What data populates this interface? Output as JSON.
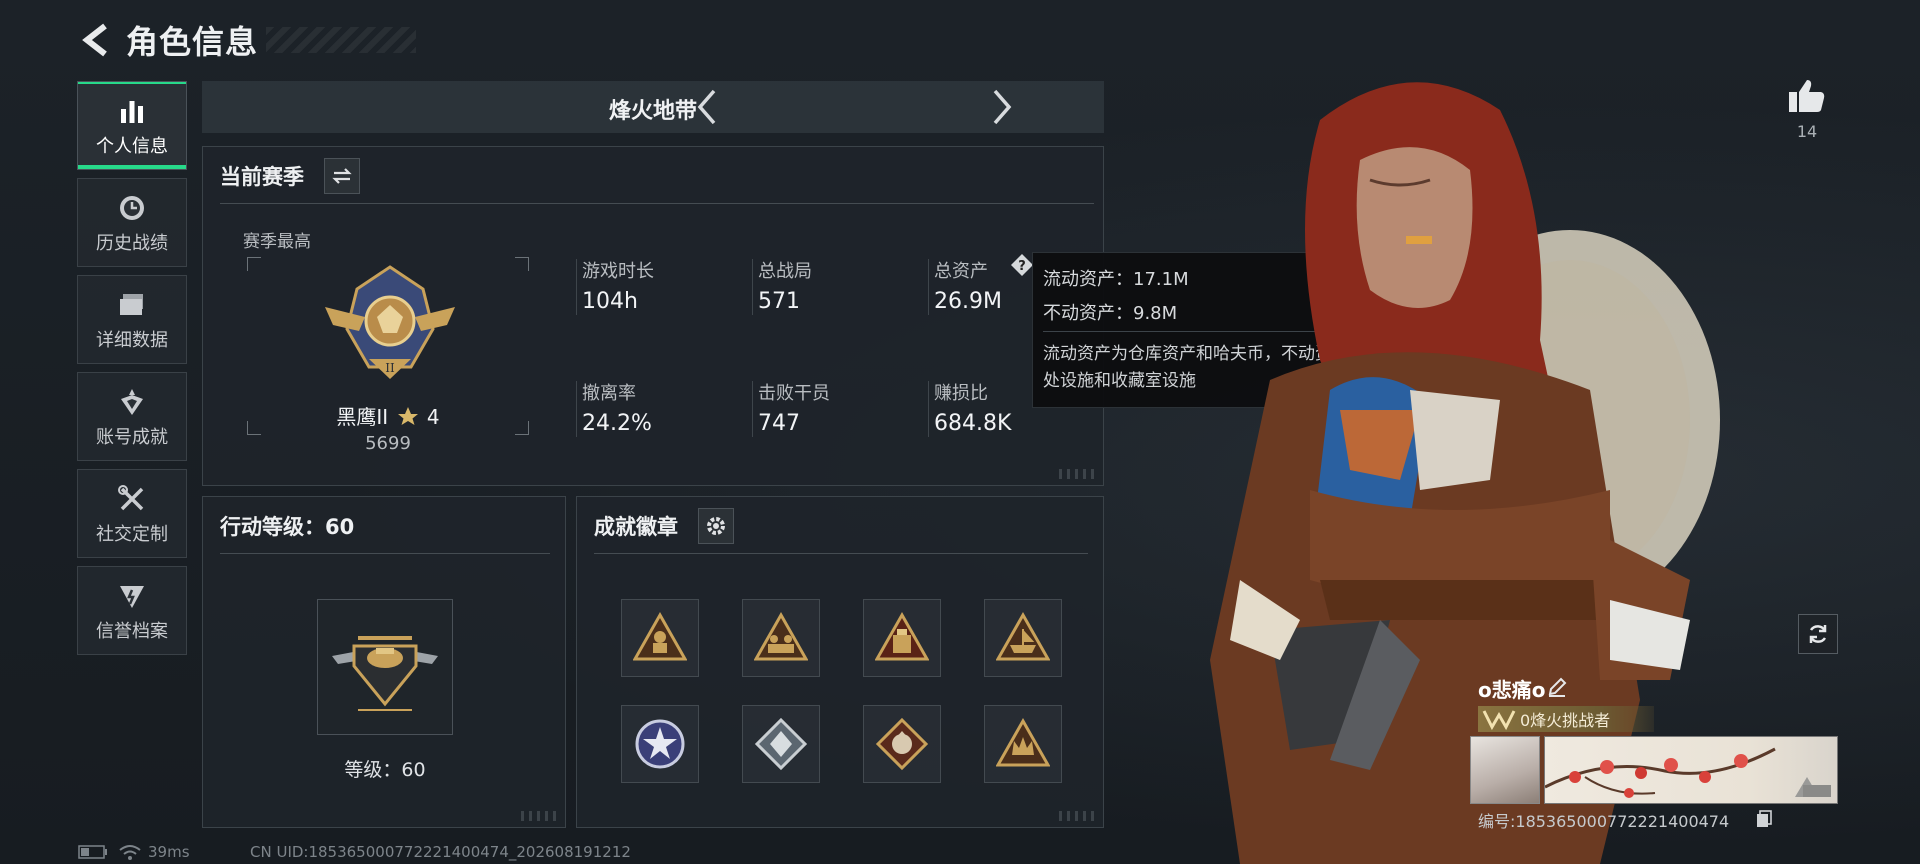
{
  "header": {
    "title": "角色信息"
  },
  "sidebar": {
    "items": [
      {
        "label": "个人信息",
        "icon": "bar-chart-icon",
        "active": true
      },
      {
        "label": "历史战绩",
        "icon": "clock-icon"
      },
      {
        "label": "详细数据",
        "icon": "folder-icon"
      },
      {
        "label": "账号成就",
        "icon": "achievement-icon"
      },
      {
        "label": "社交定制",
        "icon": "tools-icon"
      },
      {
        "label": "信誉档案",
        "icon": "shield-icon"
      }
    ]
  },
  "mode": {
    "name": "烽火地带"
  },
  "season": {
    "title": "当前赛季",
    "best_label": "赛季最高",
    "rank_name": "黑鹰II",
    "rank_stars": "4",
    "rank_score": "5699",
    "stats": [
      {
        "label": "游戏时长",
        "value": "104h"
      },
      {
        "label": "总战局",
        "value": "571"
      },
      {
        "label": "总资产",
        "value": "26.9M"
      },
      {
        "label": "撤离率",
        "value": "24.2%"
      },
      {
        "label": "击败干员",
        "value": "747"
      },
      {
        "label": "赚损比",
        "value": "684.8K"
      }
    ]
  },
  "tooltip": {
    "liquid": "流动资产：17.1M",
    "fixed": "不动资产：9.8M",
    "desc": "流动资产为仓库资产和哈夫币，不动资产为特勤处设施和收藏室设施"
  },
  "action_level": {
    "title": "行动等级：60",
    "level_text": "等级：60"
  },
  "badges": {
    "title": "成就徽章",
    "count": 8
  },
  "likes": {
    "count": "14"
  },
  "player": {
    "name": "o悲痛o",
    "rank_tag": "0烽火挑战者",
    "id_line": "编号:185365000772221400474"
  },
  "status": {
    "ping": "39ms",
    "uid": "CN UID:185365000772221400474_202608191212"
  },
  "colors": {
    "accent": "#27d98a",
    "gold": "#c9a25a"
  }
}
